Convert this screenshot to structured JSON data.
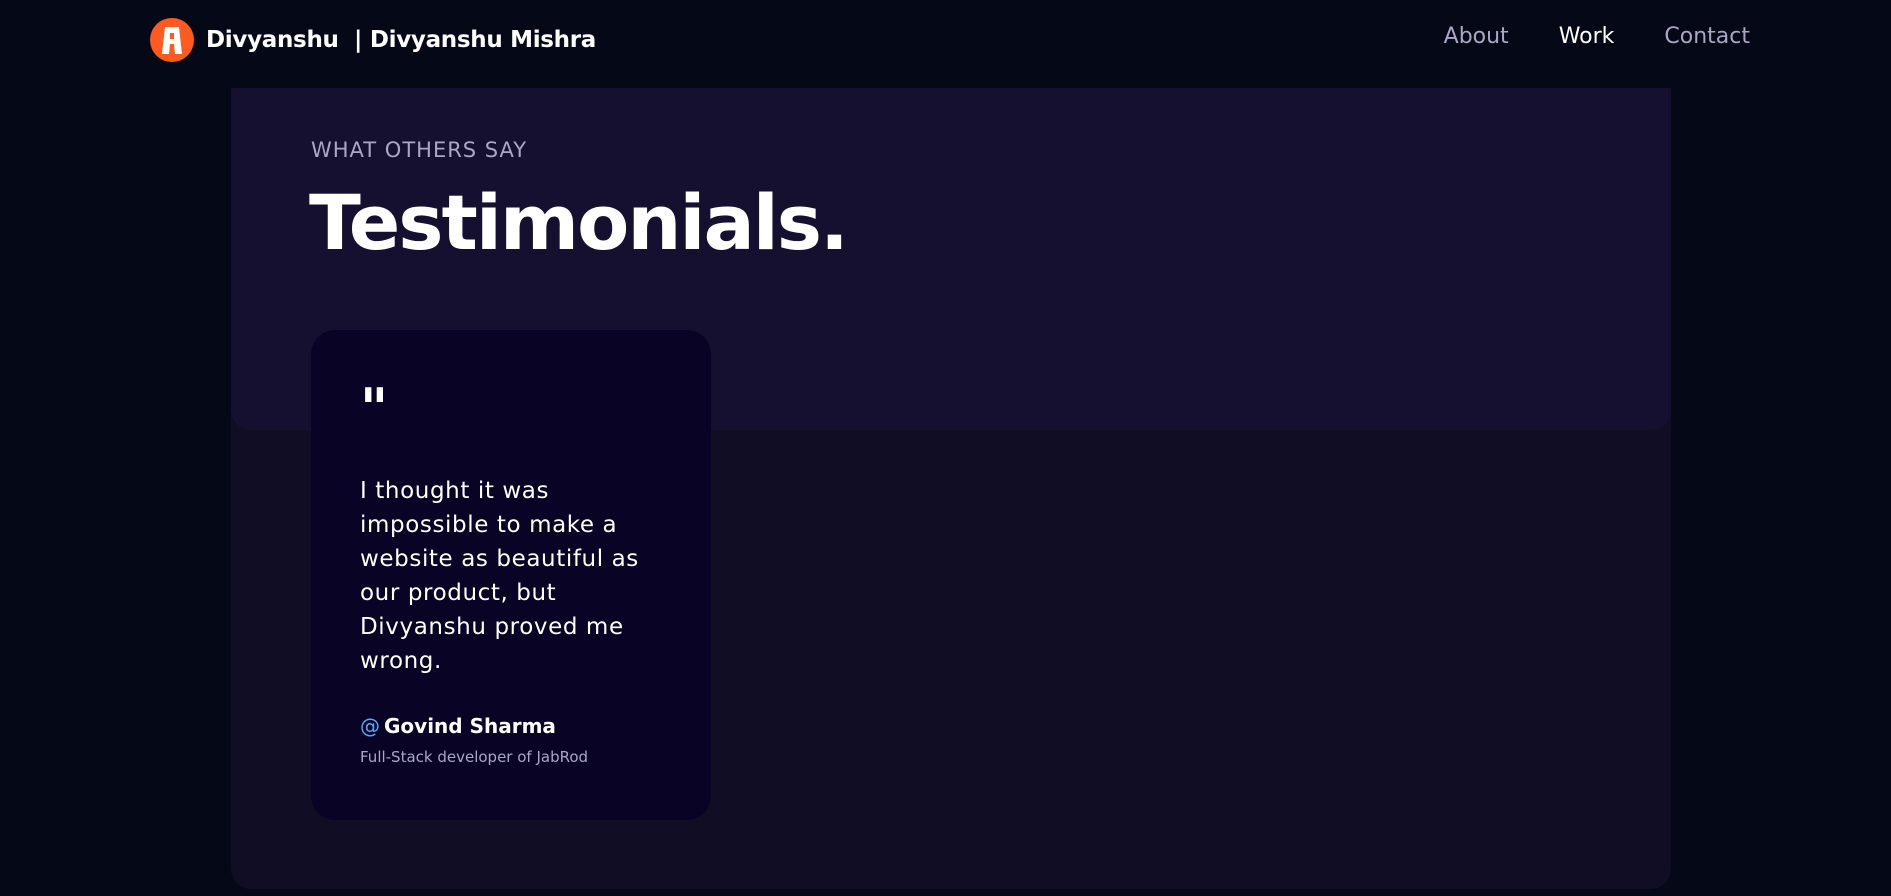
{
  "navbar": {
    "brand": "Divyanshu  | Divyanshu Mishra",
    "links": [
      {
        "label": "About"
      },
      {
        "label": "Work"
      },
      {
        "label": "Contact"
      }
    ]
  },
  "testimonials": {
    "subtitle": "WHAT OTHERS SAY",
    "title": "Testimonials.",
    "items": [
      {
        "quote_mark": "\"",
        "text": "I thought it was impossible to make a website as beautiful as our product, but Divyanshu proved me wrong.",
        "at": "@",
        "name": "Govind Sharma",
        "role": "Full-Stack developer of JabRod"
      }
    ]
  },
  "colors": {
    "background": "#050816",
    "section": "#100d25",
    "section_head": "#151030",
    "card": "#090325",
    "logo": "#ff5a1f",
    "muted_text": "#aaa6c3",
    "accent_at": "#5aa7ff"
  }
}
